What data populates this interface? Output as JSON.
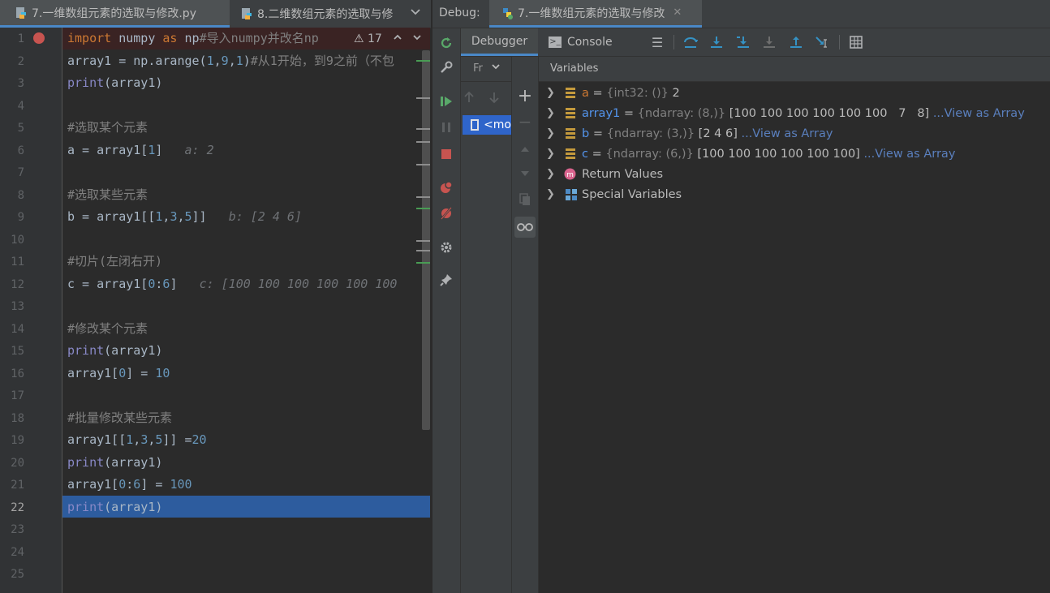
{
  "editor": {
    "tabs": [
      {
        "label": "7.一维数组元素的选取与修改.py",
        "active": true
      },
      {
        "label": "8.二维数组元素的选取与修"
      }
    ],
    "warnings_count": "17",
    "line_numbers": [
      "1",
      "2",
      "3",
      "4",
      "5",
      "6",
      "7",
      "8",
      "9",
      "10",
      "11",
      "12",
      "13",
      "14",
      "15",
      "16",
      "17",
      "18",
      "19",
      "20",
      "21",
      "22",
      "23",
      "24",
      "25"
    ],
    "current_line": "22",
    "breakpoint_line": "1",
    "code_lines": [
      "import numpy as np#导入numpy并改名np",
      "array1 = np.arange(1,9,1)#从1开始，到9之前（不包",
      "print(array1)",
      "",
      "#选取某个元素",
      "a = array1[1]",
      "",
      "#选取某些元素",
      "b = array1[[1,3,5]]",
      "",
      "#切片(左闭右开)",
      "c = array1[0:6]",
      "",
      "#修改某个元素",
      "print(array1)",
      "array1[0] = 10",
      "",
      "#批量修改某些元素",
      "array1[[1,3,5]] =20",
      "print(array1)",
      "array1[0:6] = 100",
      "print(array1)"
    ],
    "inline_hints": {
      "line6": "a: 2",
      "line9": "b: [2 4 6]",
      "line12": "c: [100 100 100 100 100 100"
    }
  },
  "debug": {
    "title": "Debug:",
    "session_tab": "7.一维数组元素的选取与修改",
    "toolbar_tabs": {
      "debugger": "Debugger",
      "console": "Console"
    },
    "frames_label": "Fr",
    "frame_item": "<mo",
    "variables_header": "Variables",
    "variables": [
      {
        "name": "a",
        "type": "{int32: ()}",
        "value": "2",
        "link": ""
      },
      {
        "name": "array1",
        "type": "{ndarray: (8,)}",
        "value": "[100 100 100 100 100 100   7   8]",
        "link": "...View as Array"
      },
      {
        "name": "b",
        "type": "{ndarray: (3,)}",
        "value": "[2 4 6]",
        "link": "...View as Array"
      },
      {
        "name": "c",
        "type": "{ndarray: (6,)}",
        "value": "[100 100 100 100 100 100]",
        "link": "...View as Array"
      }
    ],
    "groups": [
      "Return Values",
      "Special Variables"
    ]
  },
  "colors": {
    "accent": "#4a88c7",
    "breakpoint": "#c75450",
    "current_line": "#2d5c9e",
    "keyword": "#cc7832",
    "number": "#6897bb"
  }
}
